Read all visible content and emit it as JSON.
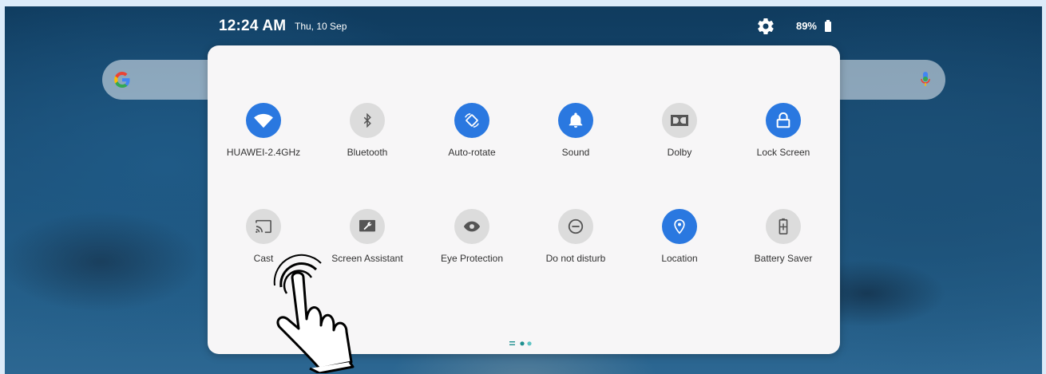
{
  "status_bar": {
    "time": "12:24 AM",
    "date": "Thu, 10 Sep",
    "battery_percent": "89%"
  },
  "search_bar": {
    "logo_letter": "G"
  },
  "quick_settings": {
    "tiles": [
      {
        "label": "HUAWEI-2.4GHz",
        "icon": "wifi-icon",
        "state": "on"
      },
      {
        "label": "Bluetooth",
        "icon": "bluetooth-icon",
        "state": "off"
      },
      {
        "label": "Auto-rotate",
        "icon": "auto-rotate-icon",
        "state": "on"
      },
      {
        "label": "Sound",
        "icon": "bell-icon",
        "state": "on"
      },
      {
        "label": "Dolby",
        "icon": "dolby-icon",
        "state": "off"
      },
      {
        "label": "Lock Screen",
        "icon": "lock-icon",
        "state": "on"
      },
      {
        "label": "Cast",
        "icon": "cast-icon",
        "state": "off"
      },
      {
        "label": "Screen Assistant",
        "icon": "wrench-icon",
        "state": "off"
      },
      {
        "label": "Eye Protection",
        "icon": "eye-icon",
        "state": "off"
      },
      {
        "label": "Do not disturb",
        "icon": "do-not-disturb-icon",
        "state": "off"
      },
      {
        "label": "Location",
        "icon": "location-pin-icon",
        "state": "on"
      },
      {
        "label": "Battery Saver",
        "icon": "battery-saver-icon",
        "state": "off"
      }
    ],
    "page_count": 2,
    "current_page": 1
  },
  "colors": {
    "accent": "#2a78e0",
    "tile_off": "#dcdcdc",
    "page_dot": "#1f8f8f"
  }
}
